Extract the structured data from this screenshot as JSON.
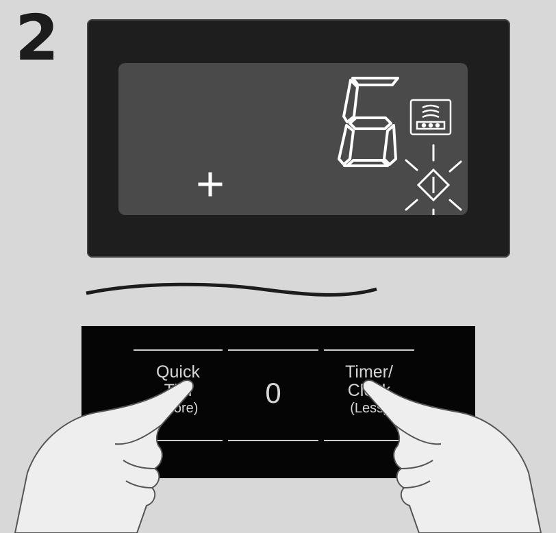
{
  "step_number": "2",
  "display": {
    "digit": "6",
    "indicator_icons": [
      "rinse-tub-icon",
      "power-lock-icon"
    ],
    "flashing_icon": "power-lock-icon"
  },
  "control_panel": {
    "buttons": [
      {
        "label_line1": "Quick",
        "label_line2": "Tim",
        "label_line3": "(More)"
      },
      {
        "label": "0"
      },
      {
        "label_line1": "Timer/",
        "label_line2": "Clock",
        "label_line3": "(Less)"
      }
    ]
  },
  "colors": {
    "background": "#d8d8d8",
    "frame": "#1e1e1e",
    "lcd": "#4a4a4a",
    "segment": "#ffffff",
    "panel": "#050505"
  }
}
